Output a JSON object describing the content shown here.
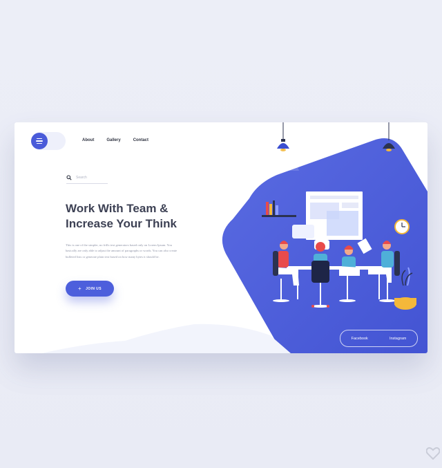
{
  "nav": {
    "menu_icon": "hamburger-menu-icon",
    "items": [
      {
        "label": "About"
      },
      {
        "label": "Gallery"
      },
      {
        "label": "Contact"
      }
    ]
  },
  "search": {
    "placeholder": "Search",
    "icon": "search-icon"
  },
  "hero": {
    "title_line1": "Work With Team &",
    "title_line2": "Increase Your Think",
    "body": "This is one of the simpler, no frills text generators based only on Lorem Ipsum. You basically are only able to adjust the amount of paragraphs or words. You can also create bulleted lists or generate plain text based on how many bytes it should be.",
    "cta_label": "JOIN US",
    "cta_icon": "plus-icon"
  },
  "social": {
    "items": [
      {
        "label": "Facebook"
      },
      {
        "label": "Instagram"
      }
    ]
  },
  "colors": {
    "primary": "#4a5bd9",
    "background": "#eceef7",
    "heading": "#3d4154",
    "accent_yellow": "#f4b83a",
    "accent_red": "#e84b4b"
  },
  "illustration": "team-meeting-illustration",
  "watermark_icon": "heart-icon"
}
